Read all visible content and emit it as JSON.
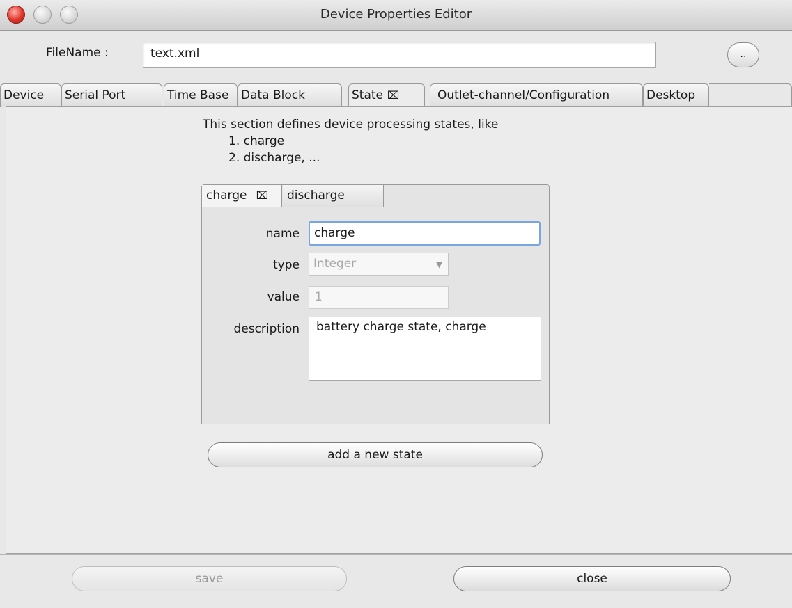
{
  "window": {
    "title": "Device Properties Editor"
  },
  "file": {
    "label": "FileName :",
    "value": "text.xml",
    "browse_label": ".."
  },
  "tabs": [
    {
      "label": "Device"
    },
    {
      "label": "Serial Port"
    },
    {
      "label": "Time Base"
    },
    {
      "label": "Data Block"
    },
    {
      "label": "State",
      "close_icon": "⌧"
    },
    {
      "label": "Outlet-channel/Configuration"
    },
    {
      "label": "Desktop"
    }
  ],
  "state_section": {
    "intro": "This section defines device processing states, like",
    "examples": [
      "1. charge",
      "2. discharge, ..."
    ],
    "inner_tabs": [
      {
        "label": "charge",
        "close_icon": "⌧"
      },
      {
        "label": "discharge"
      }
    ],
    "form": {
      "name_label": "name",
      "name_value": "charge",
      "type_label": "type",
      "type_value": "Integer",
      "value_label": "value",
      "value_value": "1",
      "description_label": "description",
      "description_value": "battery charge state, charge"
    },
    "add_button": "add a new state"
  },
  "footer": {
    "save_label": "save",
    "close_label": "close"
  }
}
